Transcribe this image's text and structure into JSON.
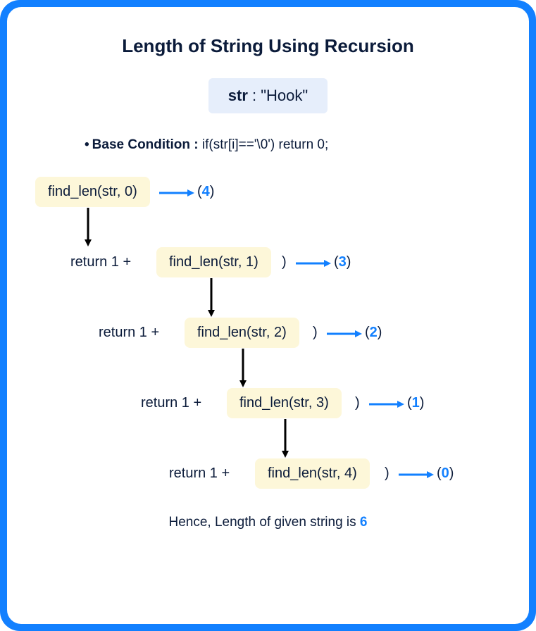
{
  "title": "Length of String Using Recursion",
  "input": {
    "label": "str",
    "colon": " : ",
    "value": "\"Hook\""
  },
  "base": {
    "bullet": "•",
    "label": "Base Condition : ",
    "code": "if(str[i]=='\\0') return 0;"
  },
  "calls": {
    "c0": "find_len(str, 0)",
    "c1": "find_len(str, 1)",
    "c2": "find_len(str, 2)",
    "c3": "find_len(str, 3)",
    "c4": "find_len(str, 4)"
  },
  "ret_label": "return  1 +",
  "close_paren": ")",
  "results": {
    "r0": "4",
    "r1": "3",
    "r2": "2",
    "r3": "1",
    "r4": "0"
  },
  "result_wrap": {
    "open": "(",
    "close": ")"
  },
  "conclusion": {
    "prefix": "Hence, Length of given string  is ",
    "value": "6"
  }
}
